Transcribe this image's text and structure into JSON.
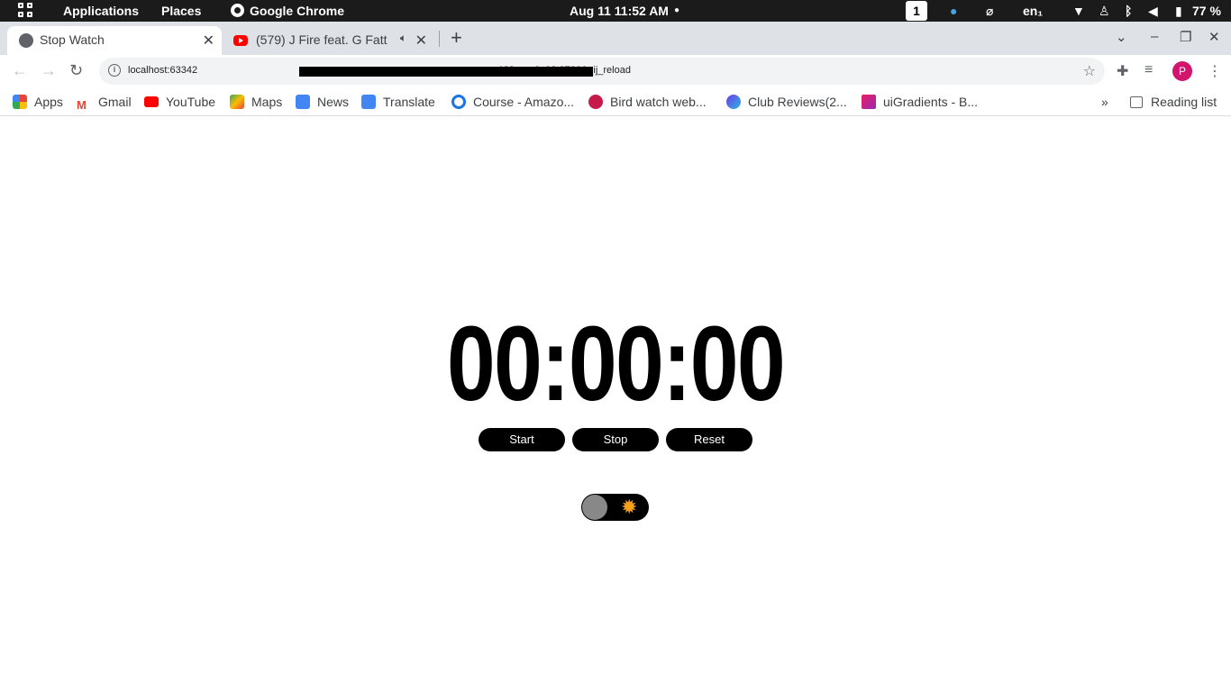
{
  "topbar": {
    "applications": "Applications",
    "places": "Places",
    "app_name": "Google Chrome",
    "datetime": "Aug 11  11:52 AM",
    "workspace": "1",
    "lang": "en₁",
    "battery": "77 %"
  },
  "tabs": [
    {
      "title": "Stop Watch",
      "active": true
    },
    {
      "title": "(579) J Fire feat. G Fatt -",
      "active": false,
      "audio": true
    }
  ],
  "toolbar": {
    "url_prefix": "localhost:63342",
    "url_suffix": "s182erpn6u02t3766&_ij_reload",
    "profile_initial": "P"
  },
  "bookmarks": [
    {
      "label": "Apps"
    },
    {
      "label": "Gmail"
    },
    {
      "label": "YouTube"
    },
    {
      "label": "Maps"
    },
    {
      "label": "News"
    },
    {
      "label": "Translate"
    },
    {
      "label": "Course - Amazo..."
    },
    {
      "label": "Bird watch web..."
    },
    {
      "label": "Club Reviews(2..."
    },
    {
      "label": "uiGradients - B..."
    }
  ],
  "bookmarks_more": "»",
  "reading_list": "Reading list",
  "stopwatch": {
    "display": "00:00:00",
    "start_label": "Start",
    "stop_label": "Stop",
    "reset_label": "Reset"
  },
  "icons": {
    "theme_toggle": "sun-icon"
  },
  "colors": {
    "button_bg": "#000000",
    "sun": "#f5a21a"
  }
}
